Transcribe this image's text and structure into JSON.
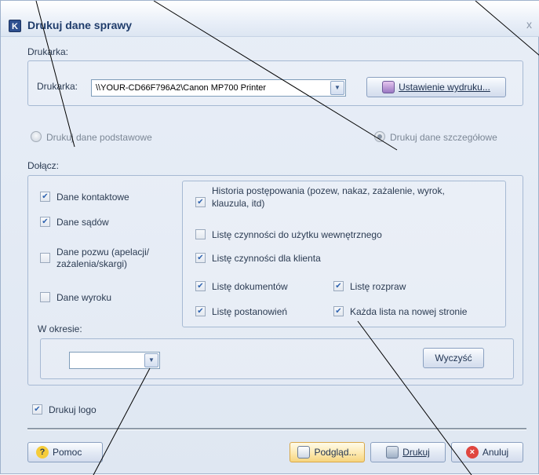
{
  "window": {
    "title": "Drukuj dane sprawy",
    "app_icon": "K",
    "close_glyph": "x"
  },
  "printer_group": {
    "legend": "Drukarka:",
    "label": "Drukarka:",
    "value": "\\\\YOUR-CD66F796A2\\Canon MP700 Printer",
    "setup_button": "Ustawienie wydruku..."
  },
  "mode": {
    "basic_label": "Drukuj dane podstawowe",
    "detailed_label": "Drukuj dane szczegółowe",
    "selected": "detailed"
  },
  "attach": {
    "legend": "Dołącz:",
    "left_items": [
      {
        "label": "Dane kontaktowe",
        "checked": true
      },
      {
        "label": "Dane sądów",
        "checked": true
      },
      {
        "label": "Dane pozwu (apelacji/",
        "label2": "zażalenia/skargi)",
        "checked": false
      },
      {
        "label": "Dane wyroku",
        "checked": false
      }
    ],
    "right_items": {
      "history": {
        "label": "Historia postępowania (pozew, nakaz, zażalenie, wyrok,",
        "label2": "klauzula, itd)",
        "checked": true
      },
      "internal": {
        "label": "Listę czynności do użytku wewnętrznego",
        "checked": false
      },
      "client": {
        "label": "Listę czynności dla klienta",
        "checked": true
      },
      "documents": {
        "label": "Listę dokumentów",
        "checked": true
      },
      "hearings": {
        "label": "Listę rozpraw",
        "checked": true
      },
      "decisions": {
        "label": "Listę postanowień",
        "checked": true
      },
      "each_new_page": {
        "label": "Każda lista na nowej stronie",
        "checked": true
      }
    },
    "period_label": "W okresie:",
    "period_value": "",
    "clear_button": "Wyczyść"
  },
  "print_logo": {
    "label": "Drukuj logo",
    "checked": true
  },
  "buttons": {
    "help": "Pomoc",
    "preview": "Podgląd...",
    "print": "Drukuj",
    "cancel": "Anuluj"
  },
  "icons": {
    "help": "help-icon",
    "preview": "preview-icon",
    "print": "printer-icon",
    "cancel": "cancel-icon",
    "setup": "printer-setup-icon"
  },
  "colors": {
    "title": "#1f3c6b",
    "dialog_bg": "#e4ebf5",
    "checkmark": "#2f63b0",
    "annotation_line": "#000000"
  }
}
